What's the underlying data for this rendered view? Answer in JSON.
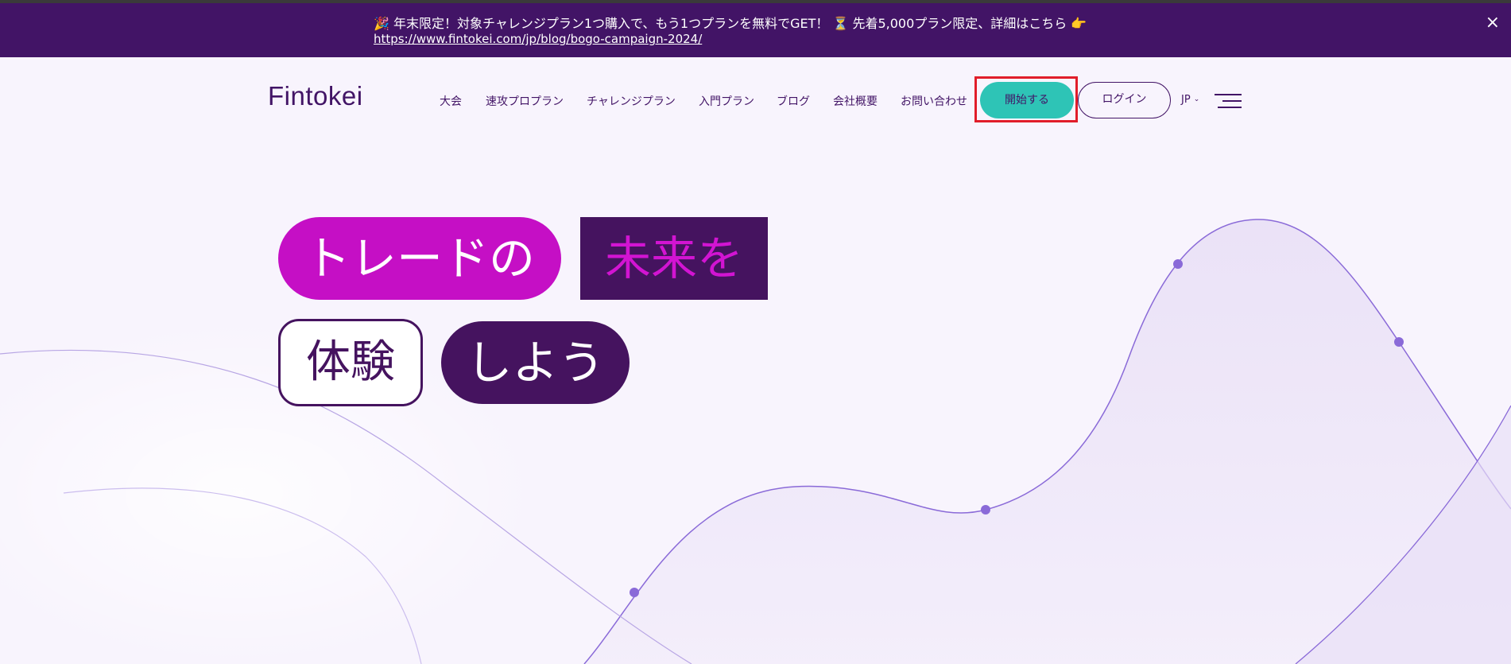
{
  "banner": {
    "line1": "🎉 年末限定！対象チャレンジプラン1つ購入で、もう1つプランを無料でGET！ ⏳ 先着5,000プラン限定、詳細はこちら 👉",
    "link": "https://www.fintokei.com/jp/blog/bogo-campaign-2024/",
    "close_icon": "×"
  },
  "nav": {
    "logo": "Fintokei",
    "items": [
      "大会",
      "速攻プロプラン",
      "チャレンジプラン",
      "入門プラン",
      "ブログ",
      "会社概要",
      "お問い合わせ"
    ],
    "start_label": "開始する",
    "login_label": "ログイン",
    "lang": "JP",
    "lang_icon": "chevron-down-icon",
    "menu_icon": "hamburger-icon"
  },
  "hero": {
    "words": [
      "トレードの",
      "未来を",
      "体験",
      "しよう"
    ]
  },
  "colors": {
    "banner_bg": "#421466",
    "brand_purple": "#421466",
    "magenta": "#c50fc5",
    "teal": "#2ec4b6",
    "page_bg": "#f8f4fd",
    "curve": "#8a6ad8"
  }
}
